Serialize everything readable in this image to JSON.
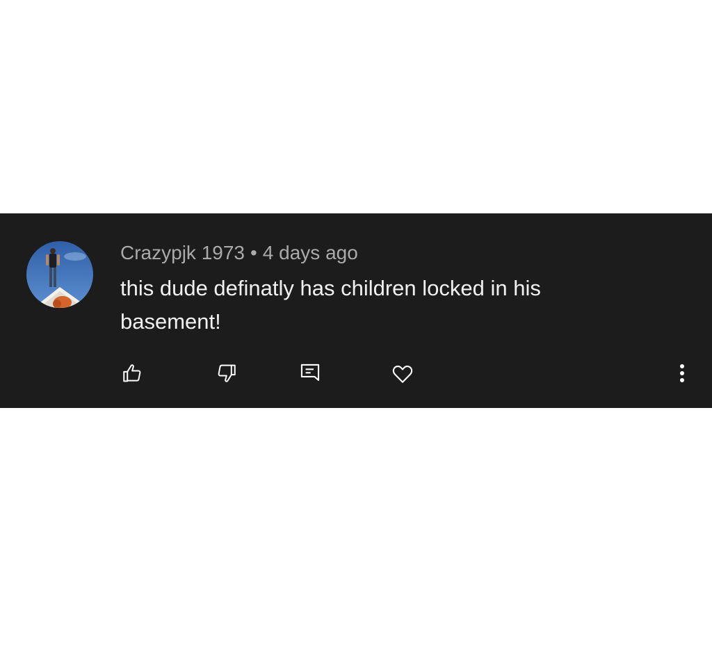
{
  "comment": {
    "author": "Crazypjk 1973",
    "separator": "•",
    "timestamp": "4 days ago",
    "text": "this dude definatly has children locked in his basement!",
    "avatar": "avatar-man-standing-on-roof"
  },
  "actions": {
    "like_icon": "thumbs-up-icon",
    "dislike_icon": "thumbs-down-icon",
    "reply_icon": "reply-comment-icon",
    "heart_icon": "heart-icon",
    "more_icon": "more-vertical-icon"
  },
  "colors": {
    "background": "#1c1c1c",
    "meta_text": "#aaaaaa",
    "body_text": "#f1f1f1",
    "icon": "#ffffff"
  }
}
